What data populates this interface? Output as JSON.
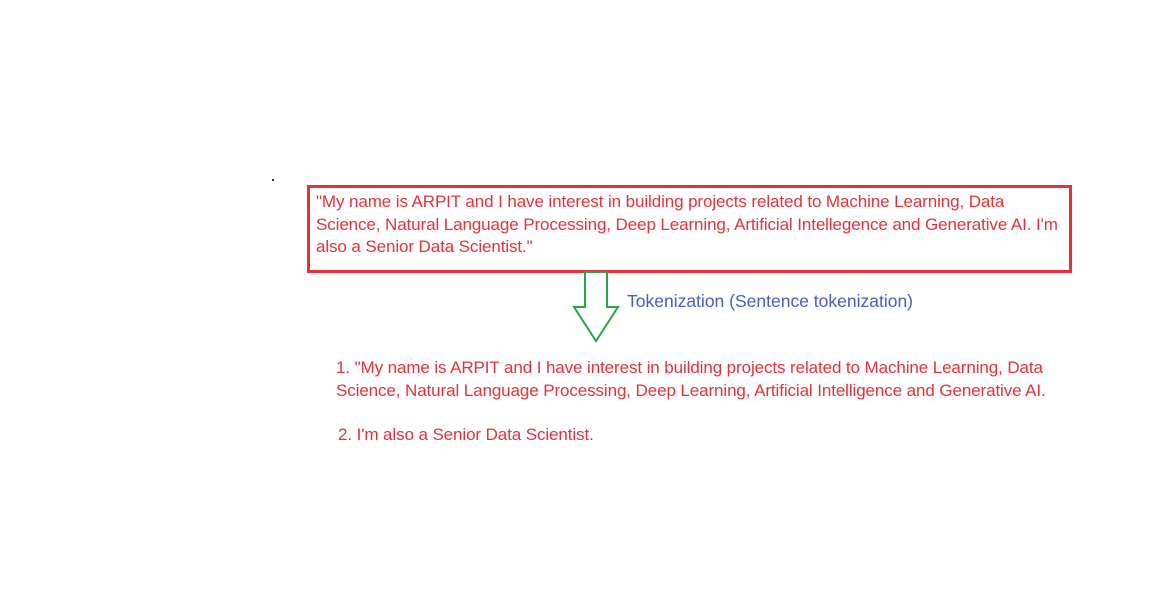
{
  "input": {
    "text": "\"My name is ARPIT and I have interest in building projects related to Machine Learning, Data Science, Natural Language Processing, Deep Learning, Artificial Intellegence and Generative AI. I'm also a Senior Data Scientist.\""
  },
  "process": {
    "label": "Tokenization (Sentence tokenization)"
  },
  "output": {
    "items": [
      "1. \"My name is ARPIT and I have interest in building projects related to Machine Learning, Data Science, Natural Language Processing, Deep Learning, Artificial Intelligence and Generative AI.",
      "2. I'm also a Senior Data Scientist."
    ]
  },
  "colors": {
    "input_border": "#e8303a",
    "text_red": "#e8303a",
    "arrow": "#22a845",
    "label_blue": "#4a5bc4"
  }
}
